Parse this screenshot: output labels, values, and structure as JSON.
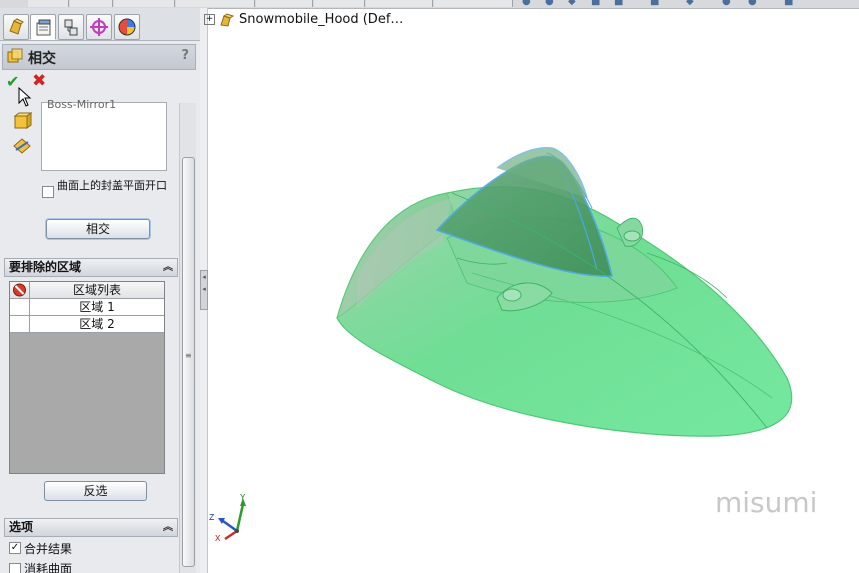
{
  "feature": {
    "title": "相交",
    "help": "?",
    "ok": "✔",
    "cancel": "✖"
  },
  "selection": {
    "items": [
      "Boss-Mirror1"
    ],
    "cap_planar_openings": "曲面上的封盖平面开口",
    "intersect_button": "相交"
  },
  "exclude_regions": {
    "header": "要排除的区域",
    "column_header": "区域列表",
    "rows": [
      "区域  1",
      "区域  2"
    ],
    "invert_button": "反选"
  },
  "options": {
    "header": "选项",
    "merge_result": "合并结果",
    "merge_checked": true,
    "consume_surfaces": "消耗曲面"
  },
  "viewport": {
    "tree_root": "Snowmobile_Hood  (Def…",
    "axis_x": "X",
    "axis_y": "Y",
    "axis_z": "Z",
    "watermark": "misumi"
  },
  "colors": {
    "body_green": "#5fe08f",
    "window_blue": "#4aa6e8",
    "ok_green": "#2a9b2a",
    "cancel_red": "#d12525"
  }
}
